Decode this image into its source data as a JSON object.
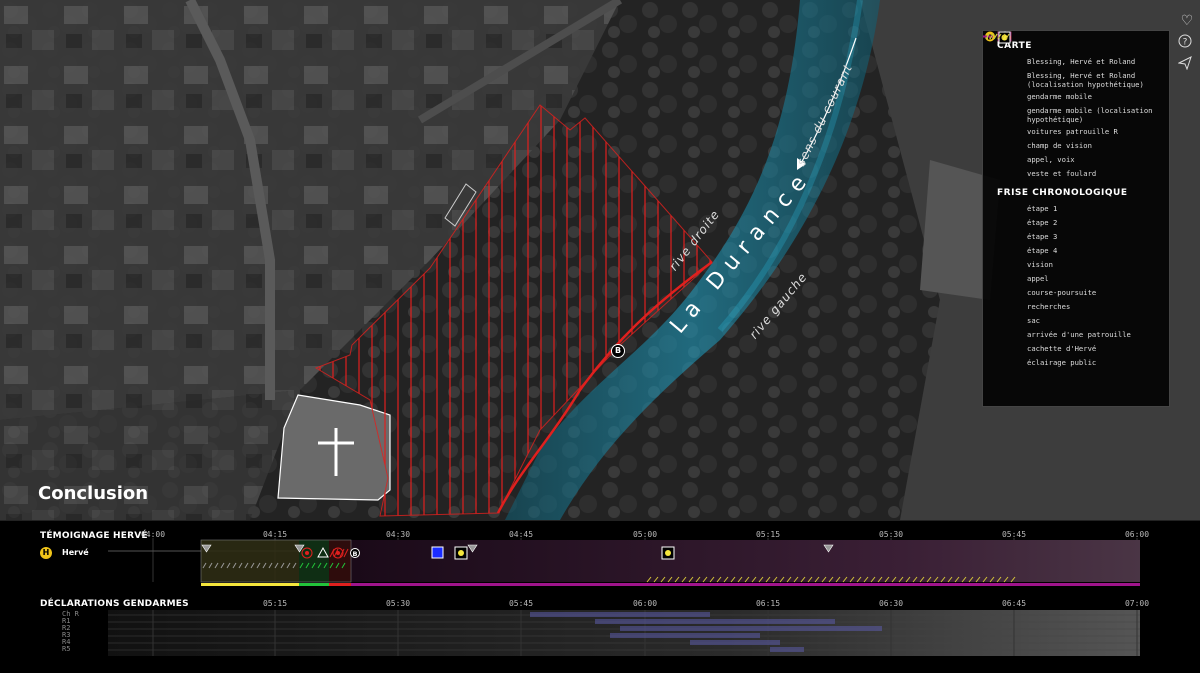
{
  "page_title": "Conclusion",
  "map": {
    "river_name": "La Durance",
    "bank_right": "rive droite",
    "bank_left": "rive gauche",
    "current": "sens du courant",
    "marker_b": "B",
    "accent_river": "#1fa3c7",
    "zone_color": "#e0201e"
  },
  "side_icons": [
    "heart-icon",
    "help-icon",
    "share-icon"
  ],
  "legend": {
    "map_heading": "CARTE",
    "map_items": [
      {
        "icon": "blessing-marker",
        "text": "Blessing, Hervé et Roland"
      },
      {
        "icon": "hypothetical-yellow-dot",
        "text": "Blessing, Hervé et Roland (localisation hypothétique)"
      },
      {
        "icon": "blue-circle",
        "text": "gendarme mobile"
      },
      {
        "icon": "hypothetical-blue-dot",
        "text": "gendarme mobile (localisation hypothétique)"
      },
      {
        "icon": "blue-square",
        "text": "voitures patrouille R"
      },
      {
        "icon": "vision-cone",
        "text": "champ de vision"
      },
      {
        "icon": "call-target",
        "text": "appel, voix"
      },
      {
        "icon": "red-hexagon",
        "text": "veste et foulard"
      }
    ],
    "timeline_heading": "FRISE CHRONOLOGIQUE",
    "timeline_items": [
      {
        "icon": "stage-yellow",
        "color": "#f5e63c",
        "text": "étape 1"
      },
      {
        "icon": "stage-green",
        "color": "#22c33a",
        "text": "étape 2"
      },
      {
        "icon": "stage-red",
        "color": "#e0201e",
        "text": "étape 3"
      },
      {
        "icon": "stage-purple",
        "color": "#a0148c",
        "text": "étape 4"
      },
      {
        "icon": "vision-triangle",
        "text": "vision"
      },
      {
        "icon": "call-target",
        "text": "appel"
      },
      {
        "icon": "hatch-white",
        "text": "course-poursuite"
      },
      {
        "icon": "hatch-green",
        "text": "recherches"
      },
      {
        "icon": "triangle-outline",
        "text": "sac"
      },
      {
        "icon": "blue-square-outline",
        "text": "arrivée d'une patrouille"
      },
      {
        "icon": "yellow-dot-square",
        "text": "cachette d'Hervé"
      },
      {
        "icon": "hatch-yellow",
        "text": "éclairage public"
      }
    ]
  },
  "timeline": {
    "herve_heading": "TÉMOIGNAGE HERVÉ",
    "herve_badge": "H",
    "herve_label": "Hervé",
    "herve_ticks": [
      "04:00",
      "04:15",
      "04:30",
      "04:45",
      "05:00",
      "05:15",
      "05:30",
      "05:45",
      "06:00"
    ],
    "gend_heading": "DÉCLARATIONS GENDARMES",
    "gend_ticks": [
      "05:15",
      "05:30",
      "05:45",
      "06:00",
      "06:15",
      "06:30",
      "06:45",
      "07:00"
    ],
    "gend_rows": [
      "Ch R",
      "R1",
      "R2",
      "R3",
      "R4",
      "R5"
    ]
  }
}
